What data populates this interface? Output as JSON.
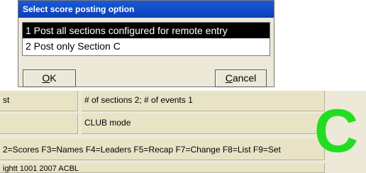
{
  "dialog": {
    "title": "Select score posting option",
    "options": [
      "1 Post all sections configured for remote entry",
      "2 Post only Section C"
    ],
    "selected_index": 0,
    "ok_label_rest": "K",
    "ok_label_mnemonic": "O",
    "cancel_label_rest": "ancel",
    "cancel_label_mnemonic": "C"
  },
  "status": {
    "row1_left": "st",
    "row1_right": "# of sections 2; # of events 1",
    "row2_left": "",
    "row2_right": "CLUB mode",
    "row3": "2=Scores F3=Names F4=Leaders F5=Recap F7=Change F8=List F9=Set",
    "row4": "    ightt 1001 2007 ACBL",
    "section_letter": "C"
  },
  "colors": {
    "title_bar": "#0b3fb8",
    "section_letter": "#22dd22",
    "selection": "#000000"
  }
}
